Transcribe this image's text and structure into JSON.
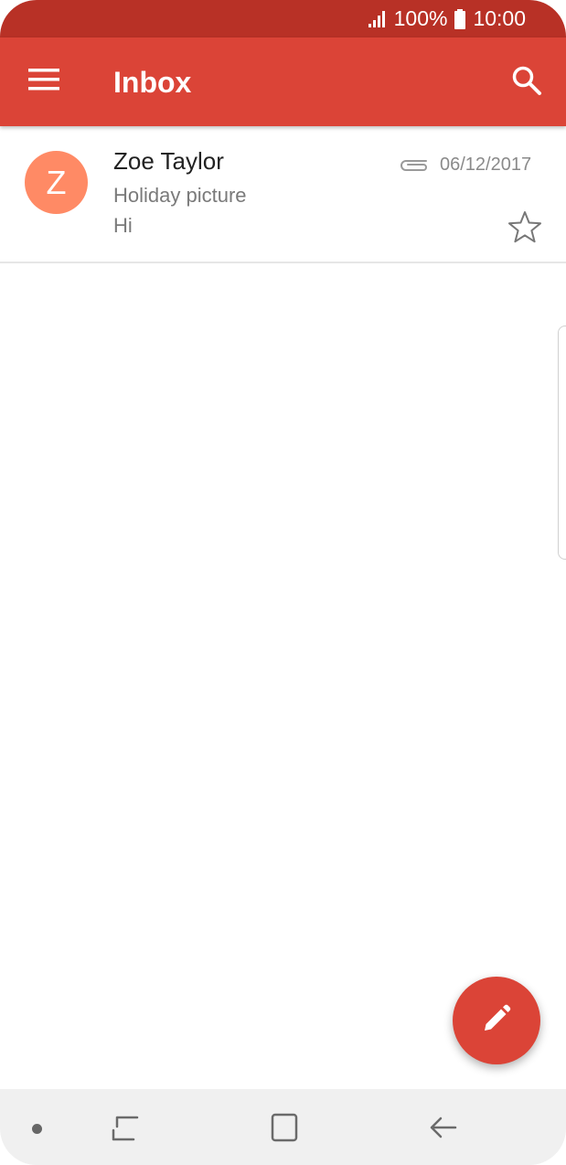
{
  "status_bar": {
    "battery_percent": "100%",
    "time": "10:00",
    "icons": [
      "signal-icon",
      "battery-icon"
    ]
  },
  "app_bar": {
    "title": "Inbox",
    "icons": [
      "menu-icon",
      "search-icon"
    ],
    "color": "#db4437"
  },
  "emails": [
    {
      "avatar_letter": "Z",
      "avatar_color": "#ff8a65",
      "sender": "Zoe Taylor",
      "subject": "Holiday picture",
      "preview": "Hi",
      "date": "06/12/2017",
      "has_attachment": true,
      "starred": false
    }
  ],
  "fab": {
    "icon": "pencil-icon"
  },
  "nav_bar": {
    "icons": [
      "dot-icon",
      "recents-icon",
      "home-icon",
      "back-icon"
    ]
  }
}
